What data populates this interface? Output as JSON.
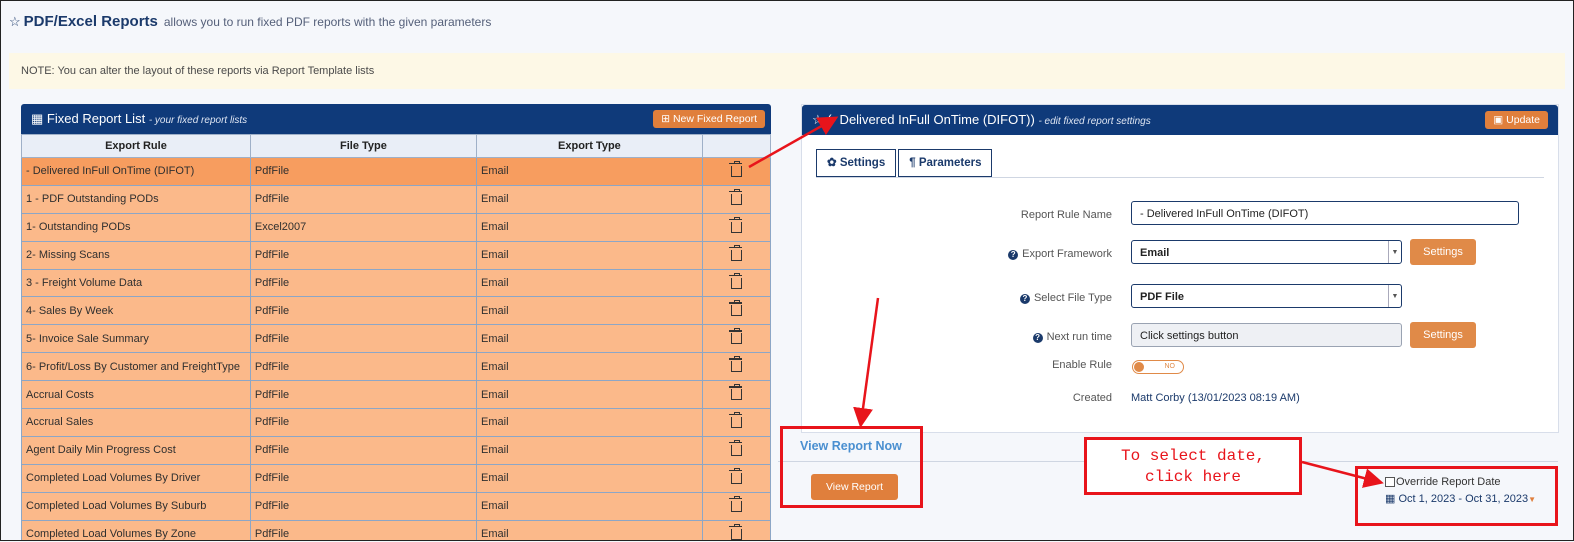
{
  "header": {
    "title": "PDF/Excel Reports",
    "subtitle": "allows you to run fixed PDF reports with the given parameters"
  },
  "note": "NOTE: You can alter the layout of these reports via Report Template lists",
  "left_panel": {
    "title": "Fixed Report List",
    "subtitle": "- your fixed report lists",
    "new_button": "New Fixed Report",
    "columns": [
      "Export Rule",
      "File Type",
      "Export Type",
      ""
    ],
    "rows": [
      {
        "rule": "- Delivered InFull OnTime (DIFOT)",
        "file": "PdfFile",
        "export": "Email"
      },
      {
        "rule": "1 - PDF Outstanding PODs",
        "file": "PdfFile",
        "export": "Email"
      },
      {
        "rule": "1- Outstanding PODs",
        "file": "Excel2007",
        "export": "Email"
      },
      {
        "rule": "2- Missing Scans",
        "file": "PdfFile",
        "export": "Email"
      },
      {
        "rule": "3 - Freight Volume Data",
        "file": "PdfFile",
        "export": "Email"
      },
      {
        "rule": "4- Sales By Week",
        "file": "PdfFile",
        "export": "Email"
      },
      {
        "rule": "5- Invoice Sale Summary",
        "file": "PdfFile",
        "export": "Email"
      },
      {
        "rule": "6- Profit/Loss By Customer and FreightType",
        "file": "PdfFile",
        "export": "Email"
      },
      {
        "rule": "Accrual Costs",
        "file": "PdfFile",
        "export": "Email"
      },
      {
        "rule": "Accrual Sales",
        "file": "PdfFile",
        "export": "Email"
      },
      {
        "rule": "Agent Daily Min Progress Cost",
        "file": "PdfFile",
        "export": "Email"
      },
      {
        "rule": "Completed Load Volumes By Driver",
        "file": "PdfFile",
        "export": "Email"
      },
      {
        "rule": "Completed Load Volumes By Suburb",
        "file": "PdfFile",
        "export": "Email"
      },
      {
        "rule": "Completed Load Volumes By Zone",
        "file": "PdfFile",
        "export": "Email"
      }
    ]
  },
  "right_panel": {
    "title": "(- Delivered InFull OnTime (DIFOT))",
    "subtitle": "- edit fixed report settings",
    "update_button": "Update",
    "tabs": [
      "Settings",
      "Parameters"
    ],
    "fields": {
      "rule_name_label": "Report Rule Name",
      "rule_name_value": "- Delivered InFull OnTime (DIFOT)",
      "framework_label": "Export Framework",
      "framework_value": "Email",
      "file_type_label": "Select File Type",
      "file_type_value": "PDF File",
      "next_run_label": "Next run time",
      "next_run_value": "Click settings button",
      "enable_label": "Enable Rule",
      "enable_value": "NO",
      "created_label": "Created",
      "created_value": "Matt Corby (13/01/2023 08:19 AM)",
      "settings_button": "Settings"
    }
  },
  "view_report": {
    "heading": "View Report Now",
    "button": "View Report",
    "override_label": "Override Report Date",
    "date_range": "Oct 1, 2023 - Oct 31, 2023"
  },
  "annotation": {
    "callout_line1": "To select date,",
    "callout_line2": "click here"
  },
  "colors": {
    "navy": "#0f3a7a",
    "orange": "#e07f3c",
    "row": "#fbb98a",
    "row_selected": "#f79d5f",
    "annotation": "#e8141b"
  }
}
